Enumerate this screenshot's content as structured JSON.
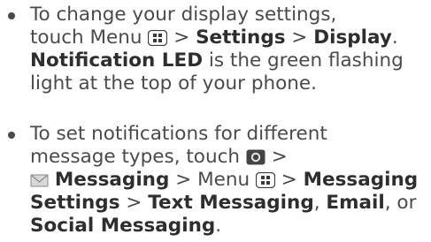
{
  "item1": {
    "l1": "To change your display settings,",
    "l2_a": "touch Menu",
    "l2_b": " > ",
    "settings": "Settings",
    "l2_c": " > ",
    "display": "Display",
    "l2_d": ".",
    "notification_led": "Notification LED",
    "l3_rest": " is the green flashing",
    "l4": "light at the top of your phone."
  },
  "item2": {
    "l1": "To set notifications for different",
    "l2_a": "message types, touch",
    "l2_b": " >",
    "messaging": "Messaging",
    "l3_a": " > Menu",
    "l3_b": " > ",
    "messaging2": "Messaging",
    "settings": "Settings",
    "l4_a": " > ",
    "text_messaging": "Text Messaging",
    "l4_b": ", ",
    "email": "Email",
    "l4_c": ", or",
    "social_messaging": "Social Messaging",
    "l5_end": "."
  },
  "icons": {
    "menu": "menu-key-icon",
    "launcher": "launcher-icon",
    "messaging": "envelope-icon"
  }
}
